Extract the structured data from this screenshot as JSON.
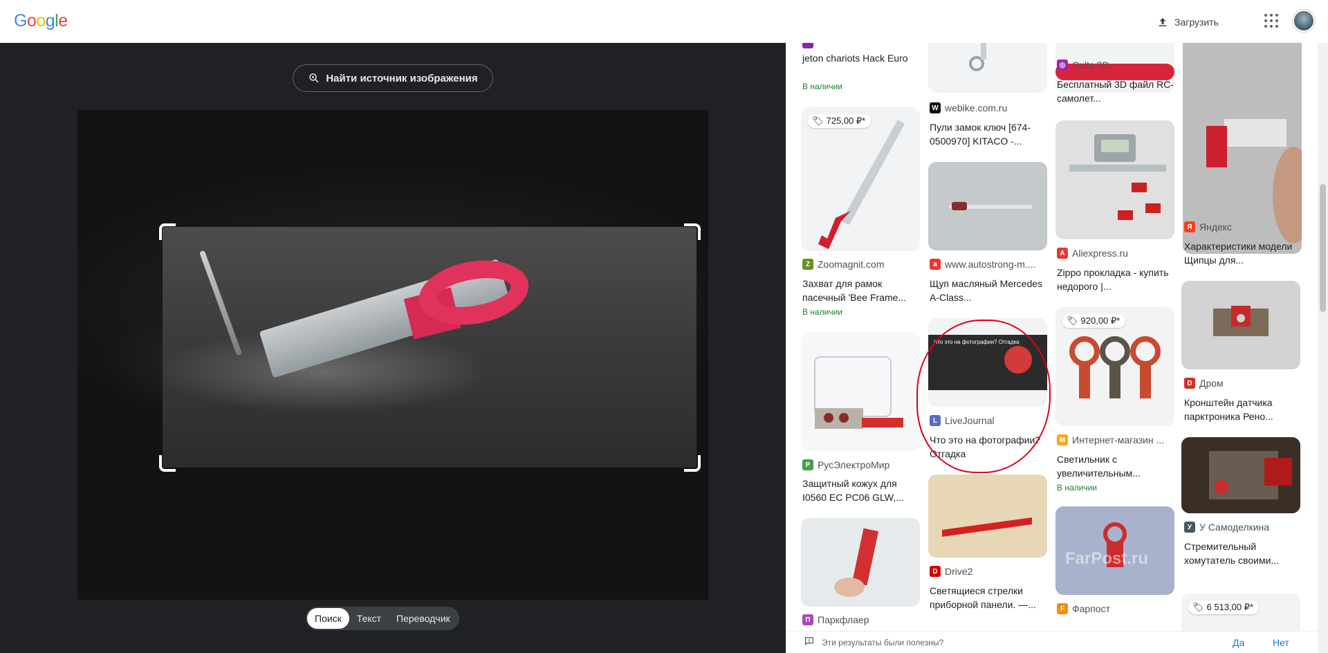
{
  "header": {
    "logo_letters": [
      {
        "ch": "G",
        "color": "#4285F4"
      },
      {
        "ch": "o",
        "color": "#EA4335"
      },
      {
        "ch": "o",
        "color": "#FBBC05"
      },
      {
        "ch": "g",
        "color": "#4285F4"
      },
      {
        "ch": "l",
        "color": "#34A853"
      },
      {
        "ch": "e",
        "color": "#EA4335"
      }
    ],
    "upload_label": "Загрузить",
    "apps_icon": "apps-grid-icon",
    "avatar_icon": "user-avatar"
  },
  "lens": {
    "find_source_label": "Найти источник изображения",
    "modes": [
      {
        "label": "Поиск",
        "active": true
      },
      {
        "label": "Текст",
        "active": false
      },
      {
        "label": "Переводчик",
        "active": false
      }
    ]
  },
  "results": [
    {
      "source": "",
      "title": "jeton chariots Hack Euro",
      "stock": "В наличии",
      "price": "",
      "fav_color": "#8e24aa",
      "fav_text": ""
    },
    {
      "source": "webike.com.ru",
      "title": "Пули замок ключ [674-0500970] KITACO -...",
      "stock": "",
      "price": "",
      "fav_color": "#111111",
      "fav_text": "W"
    },
    {
      "source": "Cults 3D",
      "title": "Бесплатный 3D файл RC-самолет...",
      "stock": "",
      "price": "",
      "fav_color": "#9c27b0",
      "fav_text": "◎"
    },
    {
      "source": "Яндекс",
      "title": "Характеристики модели Щипцы для...",
      "stock": "",
      "price": "",
      "fav_color": "#fc3f1d",
      "fav_text": "Я"
    },
    {
      "source": "Zoomagnit.com",
      "title": "Захват для рамок пасечный 'Bee Frame...",
      "stock": "В наличии",
      "price": "725,00 ₽*",
      "fav_color": "#6b8e23",
      "fav_text": "Z"
    },
    {
      "source": "www.autostrong-m....",
      "title": "Щуп масляный Mercedes A-Class...",
      "stock": "",
      "price": "",
      "fav_color": "#e53935",
      "fav_text": "a"
    },
    {
      "source": "Aliexpress.ru",
      "title": "Zippo прокладка - купить недорого |...",
      "stock": "",
      "price": "",
      "fav_color": "#e53935",
      "fav_text": "A"
    },
    {
      "source": "Дром",
      "title": "Кронштейн датчика парктроника Рено...",
      "stock": "",
      "price": "",
      "fav_color": "#d32f2f",
      "fav_text": "D"
    },
    {
      "source": "РусЭлектроМир",
      "title": "Защитный кожух для I0560 EC PC06 GLW,...",
      "stock": "",
      "price": "",
      "fav_color": "#43a047",
      "fav_text": "Р"
    },
    {
      "source": "LiveJournal",
      "title": "Что это на фотографии? Отгадка",
      "stock": "",
      "price": "",
      "fav_color": "#5c6bc0",
      "fav_text": "L",
      "thumb_caption": "Что это на фотографии? Отгадка"
    },
    {
      "source": "Интернет-магазин ...",
      "title": "Светильник с увеличительным...",
      "stock": "В наличии",
      "price": "920,00 ₽*",
      "fav_color": "#f9a825",
      "fav_text": "M"
    },
    {
      "source": "У Самоделкина",
      "title": "Стремительный хомутатель своими...",
      "stock": "",
      "price": "",
      "fav_color": "#455a64",
      "fav_text": "У"
    },
    {
      "source": "Паркфлаер",
      "title": "",
      "stock": "",
      "price": "",
      "fav_color": "#ab47bc",
      "fav_text": "П"
    },
    {
      "source": "Drive2",
      "title": "Светящиеся стрелки приборной панели. —...",
      "stock": "",
      "price": "",
      "fav_color": "#d50000",
      "fav_text": "D"
    },
    {
      "source": "Фарпост",
      "title": "",
      "stock": "",
      "price": "",
      "fav_color": "#fb8c00",
      "fav_text": "F",
      "thumb_caption": "FarPost.ru"
    },
    {
      "source": "",
      "title": "",
      "stock": "",
      "price": "6 513,00 ₽*",
      "fav_color": "#999999",
      "fav_text": ""
    }
  ],
  "feedback": {
    "question": "Эти результаты были полезны?",
    "yes": "Да",
    "no": "Нет"
  }
}
